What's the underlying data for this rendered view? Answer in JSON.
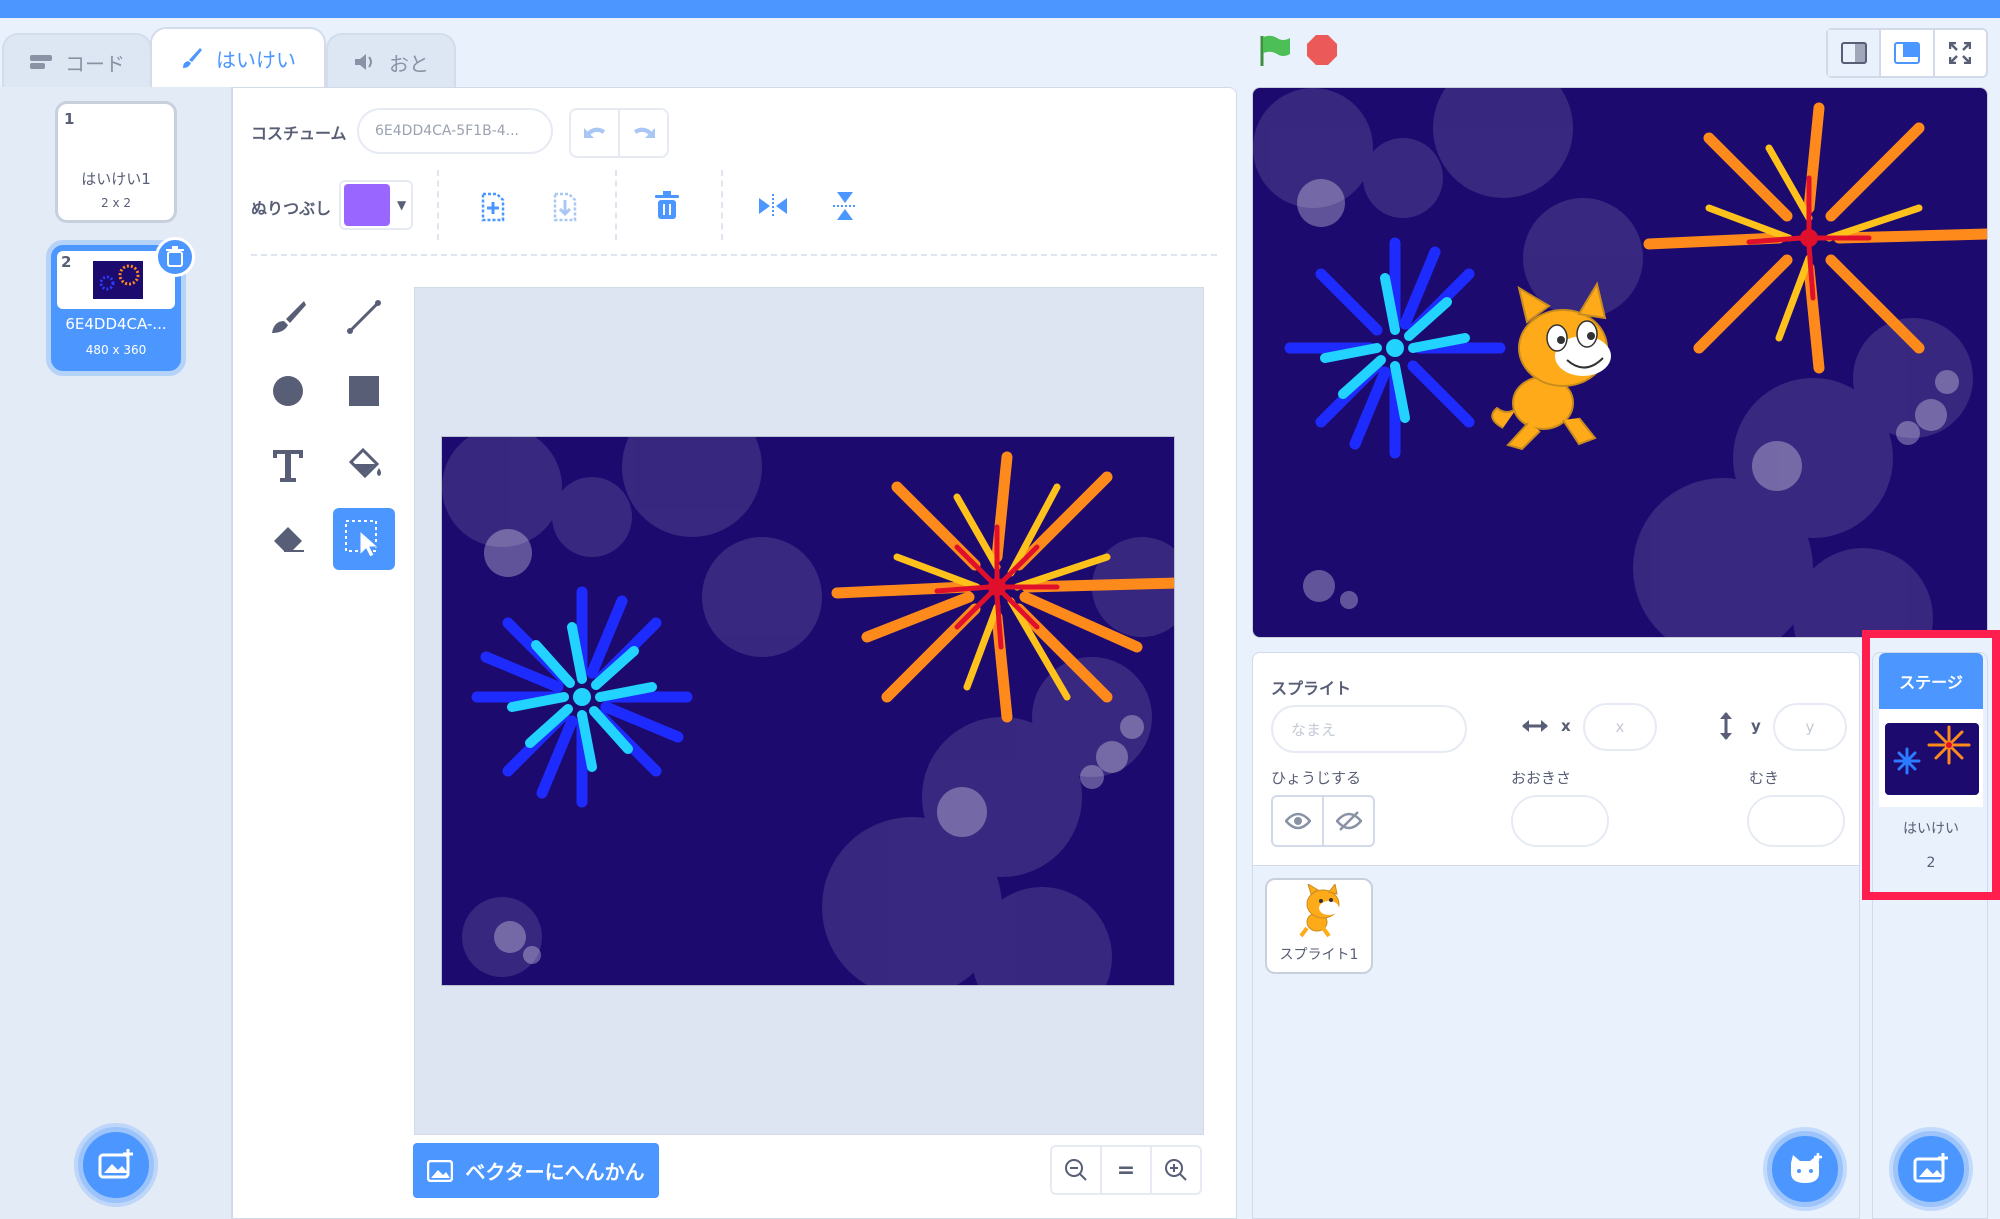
{
  "tabs": [
    {
      "label": "コード",
      "icon": "code-icon"
    },
    {
      "label": "はいけい",
      "icon": "brush-icon"
    },
    {
      "label": "おと",
      "icon": "speaker-icon"
    }
  ],
  "costumes": [
    {
      "num": "1",
      "name": "はいけい1",
      "size": "2 x 2"
    },
    {
      "num": "2",
      "name": "6E4DD4CA-...",
      "size": "480 x 360"
    }
  ],
  "editor": {
    "costume_label": "コスチューム",
    "costume_name": "6E4DD4CA-5F1B-4...",
    "fill_label": "ぬりつぶし",
    "fill_color": "#9966ff",
    "convert_label": "ベクターにへんかん",
    "zoom_reset": "="
  },
  "stage_controls": {
    "green_flag": "green-flag-icon",
    "stop": "stop-icon"
  },
  "sprite_info": {
    "sprite_label": "スプライト",
    "name_placeholder": "なまえ",
    "x_label": "x",
    "x_placeholder": "x",
    "y_label": "y",
    "y_placeholder": "y",
    "show_label": "ひょうじする",
    "size_label": "おおきさ",
    "direction_label": "むき"
  },
  "sprites": [
    {
      "name": "スプライト1"
    }
  ],
  "stage_pane": {
    "header": "ステージ",
    "backdrop_label": "はいけい",
    "backdrop_count": "2"
  },
  "colors": {
    "accent": "#4c97ff",
    "highlight": "#ff1f4f",
    "stage_bg": "#1d0a6e"
  }
}
